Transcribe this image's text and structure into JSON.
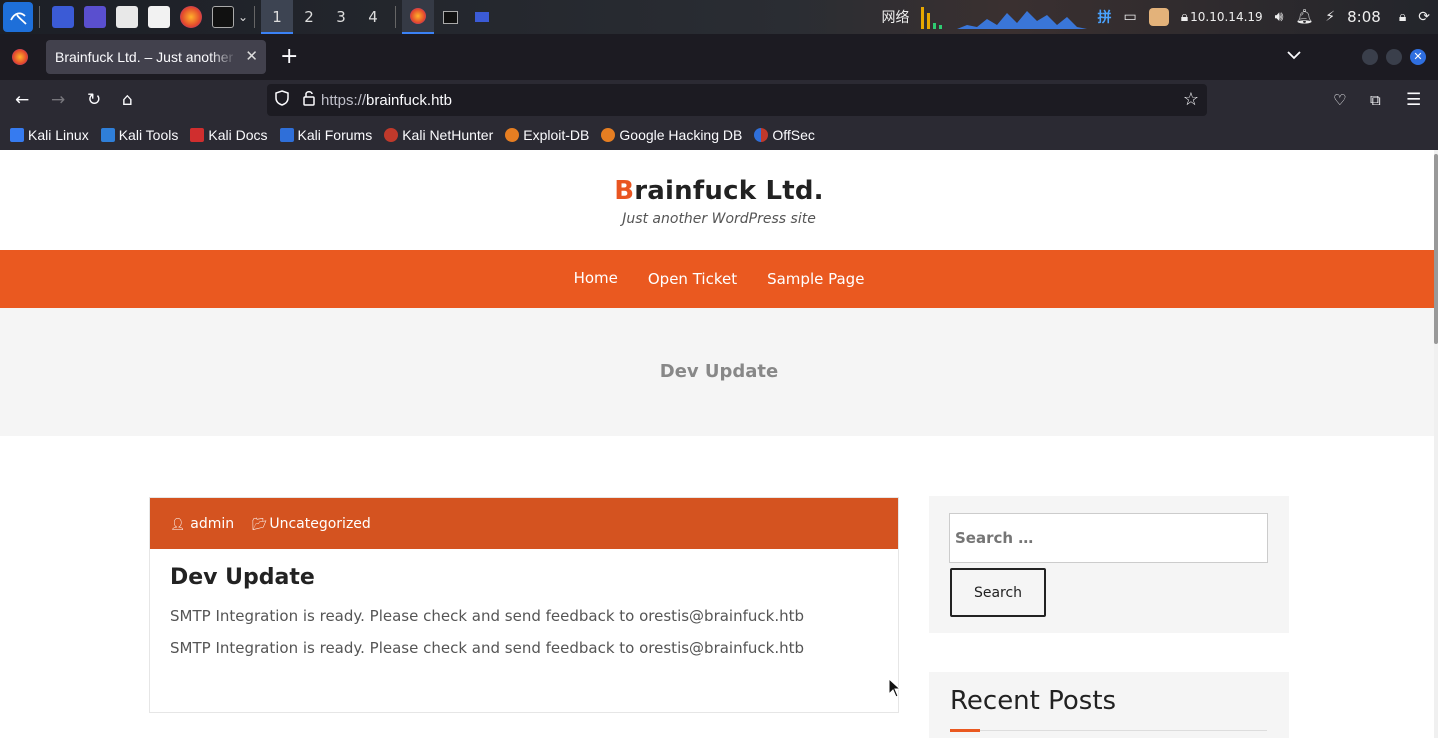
{
  "taskbar": {
    "workspaces": [
      "1",
      "2",
      "3",
      "4"
    ],
    "network_label": "网络",
    "input_method": "拼",
    "ip": "10.10.14.19",
    "clock": "8:08"
  },
  "browser": {
    "tab_title": "Brainfuck Ltd. – Just another WordPress site",
    "url_proto": "https://",
    "url_host": "brainfuck.htb",
    "bookmarks": [
      "Kali Linux",
      "Kali Tools",
      "Kali Docs",
      "Kali Forums",
      "Kali NetHunter",
      "Exploit-DB",
      "Google Hacking DB",
      "OffSec"
    ]
  },
  "site": {
    "title_first": "B",
    "title_rest": "rainfuck Ltd.",
    "tagline": "Just another WordPress site",
    "menu": [
      "Home",
      "Open Ticket",
      "Sample Page"
    ],
    "hero_title": "Dev Update"
  },
  "post": {
    "author": "admin",
    "category": "Uncategorized",
    "title": "Dev Update",
    "paragraphs": [
      "SMTP Integration is ready. Please check and send feedback to orestis@brainfuck.htb",
      "SMTP Integration is ready. Please check and send feedback to orestis@brainfuck.htb"
    ]
  },
  "sidebar": {
    "search_placeholder": "Search …",
    "search_button": "Search",
    "recent_title": "Recent Posts"
  },
  "colors": {
    "accent": "#ea5920",
    "meta_bar": "#d45320"
  }
}
